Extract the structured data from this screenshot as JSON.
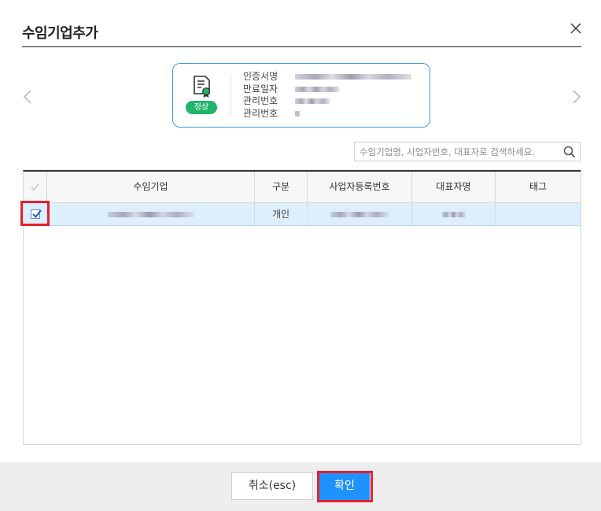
{
  "dialog": {
    "title": "수임기업추가",
    "close_icon": "close-icon"
  },
  "certificate": {
    "icon": "certificate-icon",
    "status_badge": "정상",
    "fields": [
      {
        "label": "인증서명"
      },
      {
        "label": "만료일자"
      },
      {
        "label": "관리번호"
      },
      {
        "label": "관리번호"
      }
    ]
  },
  "search": {
    "value": "",
    "placeholder": "수임기업명, 사업자번호, 대표자로 검색하세요.",
    "icon": "search-icon"
  },
  "table": {
    "columns": [
      "",
      "수임기업",
      "구분",
      "사업자등록번호",
      "대표자명",
      "태그"
    ],
    "rows": [
      {
        "checked": true,
        "type": "개인"
      }
    ]
  },
  "footer": {
    "cancel_label": "취소(esc)",
    "ok_label": "확인"
  },
  "colors": {
    "accent": "#1e93ff",
    "badge": "#1fb56b",
    "highlight": "#e8202a",
    "row_selected": "#ddeefc"
  }
}
